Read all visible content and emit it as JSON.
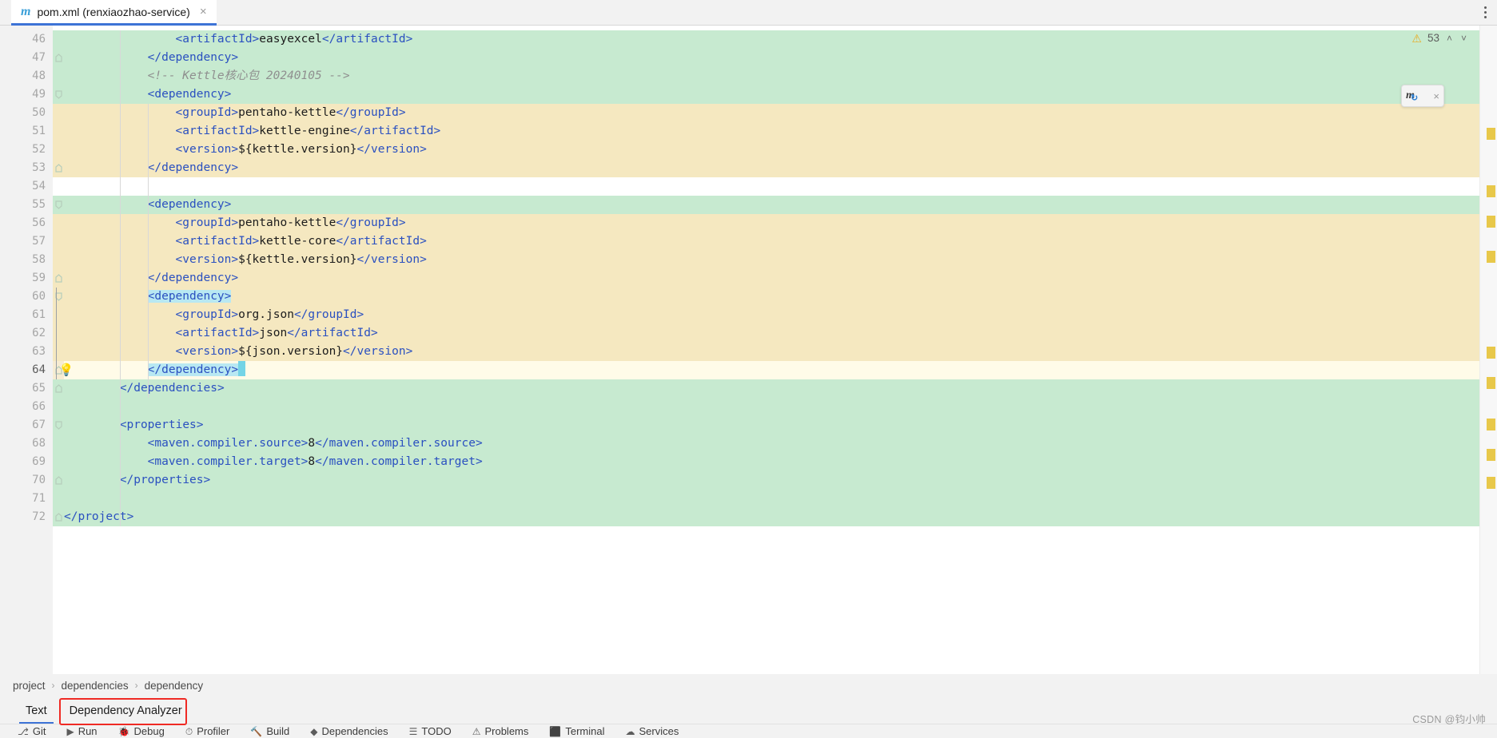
{
  "window": {
    "tab": {
      "title": "pom.xml (renxiaozhao-service)",
      "icon": "maven-icon",
      "close": "×"
    },
    "menu_icon": "more-options-icon"
  },
  "inspections": {
    "warning_icon": "warning-triangle-icon",
    "warning_count": "53",
    "prev_label": "˄",
    "next_label": "˅"
  },
  "maven_popup": {
    "reload_icon": "maven-reload-icon",
    "reload_glyph": "m",
    "close_label": "×"
  },
  "editor": {
    "first_line": 46,
    "caret_line": 64,
    "lines": [
      {
        "n": 46,
        "indent": 4,
        "bg": "green",
        "text": "<artifactId>easyexcel</artifactId>",
        "kind": "tag"
      },
      {
        "n": 47,
        "indent": 3,
        "bg": "green",
        "text": "</dependency>",
        "kind": "tag"
      },
      {
        "n": 48,
        "indent": 3,
        "bg": "green",
        "text": "<!-- Kettle核心包 20240105 -->",
        "kind": "comment"
      },
      {
        "n": 49,
        "indent": 3,
        "bg": "green",
        "text": "<dependency>",
        "kind": "tag"
      },
      {
        "n": 50,
        "indent": 4,
        "bg": "tan",
        "text": "<groupId>pentaho-kettle</groupId>",
        "kind": "tag"
      },
      {
        "n": 51,
        "indent": 4,
        "bg": "tan",
        "text": "<artifactId>kettle-engine</artifactId>",
        "kind": "tag"
      },
      {
        "n": 52,
        "indent": 4,
        "bg": "tan",
        "text": "<version>${kettle.version}</version>",
        "kind": "tag"
      },
      {
        "n": 53,
        "indent": 3,
        "bg": "tan",
        "text": "</dependency>",
        "kind": "tag"
      },
      {
        "n": 54,
        "indent": 0,
        "bg": "none",
        "text": "",
        "kind": "blank"
      },
      {
        "n": 55,
        "indent": 3,
        "bg": "green",
        "text": "<dependency>",
        "kind": "tag"
      },
      {
        "n": 56,
        "indent": 4,
        "bg": "tan",
        "text": "<groupId>pentaho-kettle</groupId>",
        "kind": "tag"
      },
      {
        "n": 57,
        "indent": 4,
        "bg": "tan",
        "text": "<artifactId>kettle-core</artifactId>",
        "kind": "tag"
      },
      {
        "n": 58,
        "indent": 4,
        "bg": "tan",
        "text": "<version>${kettle.version}</version>",
        "kind": "tag"
      },
      {
        "n": 59,
        "indent": 3,
        "bg": "tan",
        "text": "</dependency>",
        "kind": "tag"
      },
      {
        "n": 60,
        "indent": 3,
        "bg": "tan",
        "text": "<dependency>",
        "kind": "tag",
        "selected": true
      },
      {
        "n": 61,
        "indent": 4,
        "bg": "tan",
        "text": "<groupId>org.json</groupId>",
        "kind": "tag"
      },
      {
        "n": 62,
        "indent": 4,
        "bg": "tan",
        "text": "<artifactId>json</artifactId>",
        "kind": "tag"
      },
      {
        "n": 63,
        "indent": 4,
        "bg": "tan",
        "text": "<version>${json.version}</version>",
        "kind": "tag"
      },
      {
        "n": 64,
        "indent": 3,
        "bg": "caret",
        "text": "</dependency>",
        "kind": "tag",
        "selected": true,
        "caret": true,
        "bulb": true
      },
      {
        "n": 65,
        "indent": 2,
        "bg": "green",
        "text": "</dependencies>",
        "kind": "tag"
      },
      {
        "n": 66,
        "indent": 0,
        "bg": "green",
        "text": "",
        "kind": "blank"
      },
      {
        "n": 67,
        "indent": 2,
        "bg": "green",
        "text": "<properties>",
        "kind": "tag"
      },
      {
        "n": 68,
        "indent": 3,
        "bg": "green",
        "text": "<maven.compiler.source>8</maven.compiler.source>",
        "kind": "tag"
      },
      {
        "n": 69,
        "indent": 3,
        "bg": "green",
        "text": "<maven.compiler.target>8</maven.compiler.target>",
        "kind": "tag"
      },
      {
        "n": 70,
        "indent": 2,
        "bg": "green",
        "text": "</properties>",
        "kind": "tag"
      },
      {
        "n": 71,
        "indent": 0,
        "bg": "green",
        "text": "",
        "kind": "blank"
      },
      {
        "n": 72,
        "indent": 0,
        "bg": "green",
        "text": "</project>",
        "kind": "tag"
      }
    ],
    "bulb_icon": "intention-lightbulb-icon",
    "fold_open_rows": [
      49,
      55,
      60,
      67
    ],
    "fold_close_rows": [
      47,
      53,
      59,
      64,
      65,
      70,
      72
    ]
  },
  "breadcrumb": {
    "separator": "›",
    "items": [
      "project",
      "dependencies",
      "dependency"
    ]
  },
  "bottom_tabs": {
    "items": [
      {
        "label": "Text",
        "active": true
      },
      {
        "label": "Dependency Analyzer",
        "active": false,
        "highlighted": true
      }
    ]
  },
  "tool_window_bar": {
    "items": [
      {
        "label": "Git",
        "icon": "git-icon"
      },
      {
        "label": "Run",
        "icon": "run-icon"
      },
      {
        "label": "Debug",
        "icon": "debug-icon"
      },
      {
        "label": "Profiler",
        "icon": "profiler-icon"
      },
      {
        "label": "Build",
        "icon": "build-icon"
      },
      {
        "label": "Dependencies",
        "icon": "dependencies-icon"
      },
      {
        "label": "TODO",
        "icon": "todo-icon"
      },
      {
        "label": "Problems",
        "icon": "problems-icon"
      },
      {
        "label": "Terminal",
        "icon": "terminal-icon"
      },
      {
        "label": "Services",
        "icon": "services-icon"
      }
    ]
  },
  "watermark": {
    "text": "CSDN @钧小帅"
  },
  "colors": {
    "accent": "#3d73d6",
    "warning": "#e8ac23",
    "selection": "#b8e8f2",
    "scope_green": "#c7ead0",
    "scope_tan": "#f5e8c0",
    "annotation_red": "#ef2a24"
  }
}
